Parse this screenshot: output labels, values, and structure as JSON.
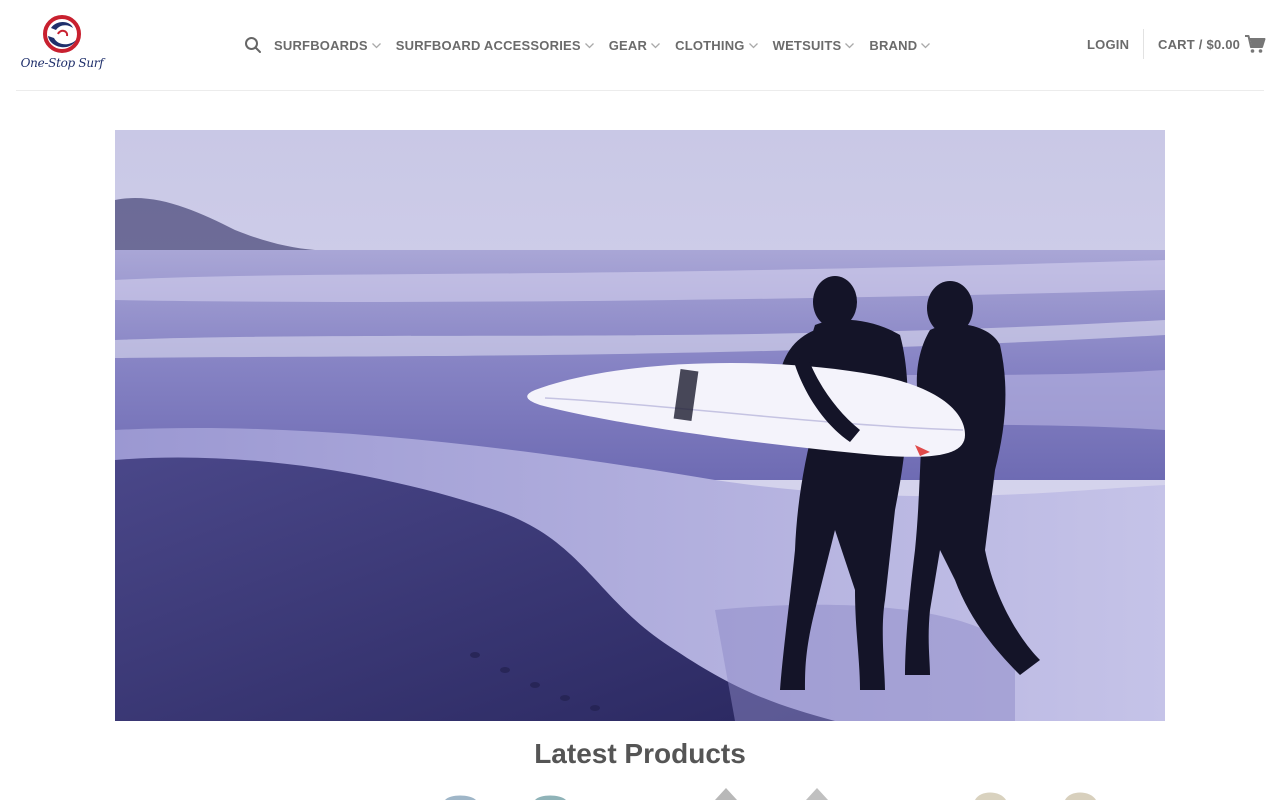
{
  "brand": {
    "name": "One-Stop Surf"
  },
  "nav": {
    "items": [
      {
        "label": "SURFBOARDS"
      },
      {
        "label": "SURFBOARD ACCESSORIES"
      },
      {
        "label": "GEAR"
      },
      {
        "label": "CLOTHING"
      },
      {
        "label": "WETSUITS"
      },
      {
        "label": "BRAND"
      }
    ]
  },
  "account": {
    "login_label": "LOGIN"
  },
  "cart": {
    "label": "CART /",
    "amount": "$0.00"
  },
  "hero": {
    "image_alt": "Two surfers in wetsuits walking on the beach carrying a surfboard"
  },
  "latest": {
    "title": "Latest Products"
  },
  "colors": {
    "brand_blue": "#1f2f6b",
    "brand_red": "#c8202f",
    "nav_text": "#6b6b6b"
  }
}
